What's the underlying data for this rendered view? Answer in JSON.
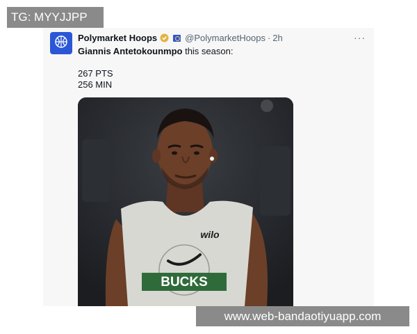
{
  "watermark": {
    "top_left": "TG: MYYJJPP",
    "bottom_right": "www.web-bandaotiyuapp.com"
  },
  "tweet": {
    "display_name": "Polymarket Hoops",
    "handle": "@PolymarketHoops",
    "separator": "·",
    "time": "2h",
    "more": "···",
    "player_name": "Giannis Antetokounmpo",
    "text_suffix": " this season:",
    "stats": [
      "267 PTS",
      "256 MIN"
    ],
    "jersey_text": "BUCKS",
    "jersey_brand": "wilo"
  },
  "colors": {
    "avatar": "#2b57d6",
    "verified": "#e3b341",
    "jersey": "#d8d8d3",
    "bucks_green": "#2f6b3a",
    "skin": "#6b3f28"
  },
  "icons": {
    "avatar": "basketball-icon",
    "verified": "verified-badge-icon",
    "flag": "flag-icon",
    "more": "more-icon"
  }
}
